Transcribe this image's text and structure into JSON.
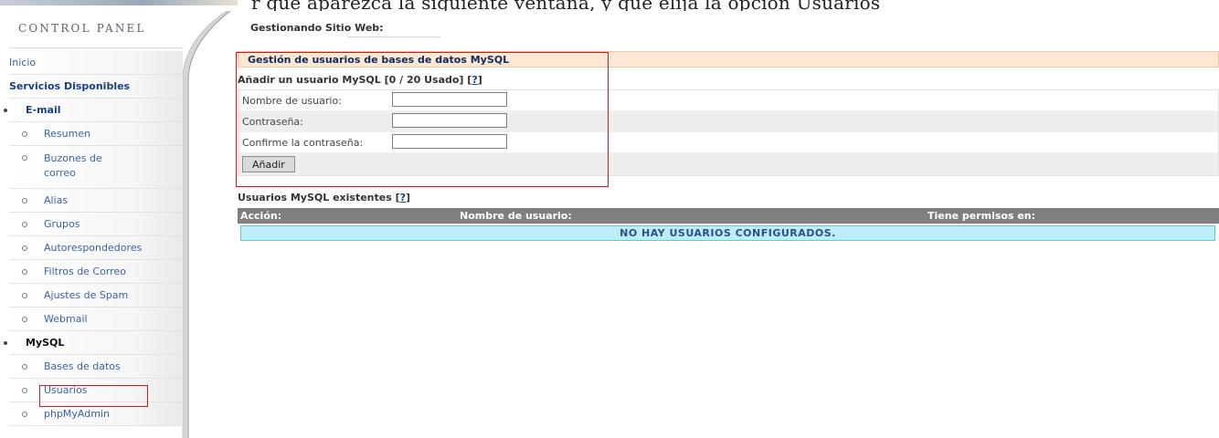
{
  "top_strip_text": "r que aparezca la siguiente ventana, y que elija la opción Usuarios",
  "sidebar": {
    "title": "CONTROL PANEL",
    "items": [
      {
        "label": "Inicio",
        "kind": "link"
      },
      {
        "label": "Servicios Disponibles",
        "kind": "section"
      },
      {
        "label": "E-mail",
        "kind": "group"
      },
      {
        "label": "Resumen",
        "kind": "sub"
      },
      {
        "label": "Buzones de correo",
        "kind": "sub"
      },
      {
        "label": "Alias",
        "kind": "sub"
      },
      {
        "label": "Grupos",
        "kind": "sub"
      },
      {
        "label": "Autorespondedores",
        "kind": "sub"
      },
      {
        "label": "Filtros de Correo",
        "kind": "sub"
      },
      {
        "label": "Ajustes de Spam",
        "kind": "sub"
      },
      {
        "label": "Webmail",
        "kind": "sub"
      },
      {
        "label": "MySQL",
        "kind": "group"
      },
      {
        "label": "Bases de datos",
        "kind": "sub"
      },
      {
        "label": "Usuarios",
        "kind": "sub",
        "highlighted": true
      },
      {
        "label": "phpMyAdmin",
        "kind": "sub"
      }
    ]
  },
  "main": {
    "site_label": "Gestionando Sitio Web:",
    "section_title": "Gestión de usuarios de bases de datos MySQL",
    "add_title": "Añadir un usuario MySQL [0 / 20 Usado] [",
    "add_help": "?",
    "add_title_end": "]",
    "form": {
      "username_label": "Nombre de usuario:",
      "password_label": "Contraseña:",
      "confirm_label": "Confirme la contraseña:",
      "username_value": "",
      "password_value": "",
      "confirm_value": "",
      "submit_label": "Añadir"
    },
    "existing_title": "Usuarios MySQL existentes [",
    "existing_help": "?",
    "existing_title_end": "]",
    "table": {
      "columns": [
        "Acción:",
        "Nombre de usuario:",
        "Tiene permisos en:"
      ],
      "empty_message": "NO HAY USUARIOS CONFIGURADOS."
    }
  },
  "colors": {
    "highlight": "#e0141b",
    "section_bar": "#fde8d6",
    "table_header": "#7f7f7f",
    "empty_row": "#bdeef8"
  }
}
